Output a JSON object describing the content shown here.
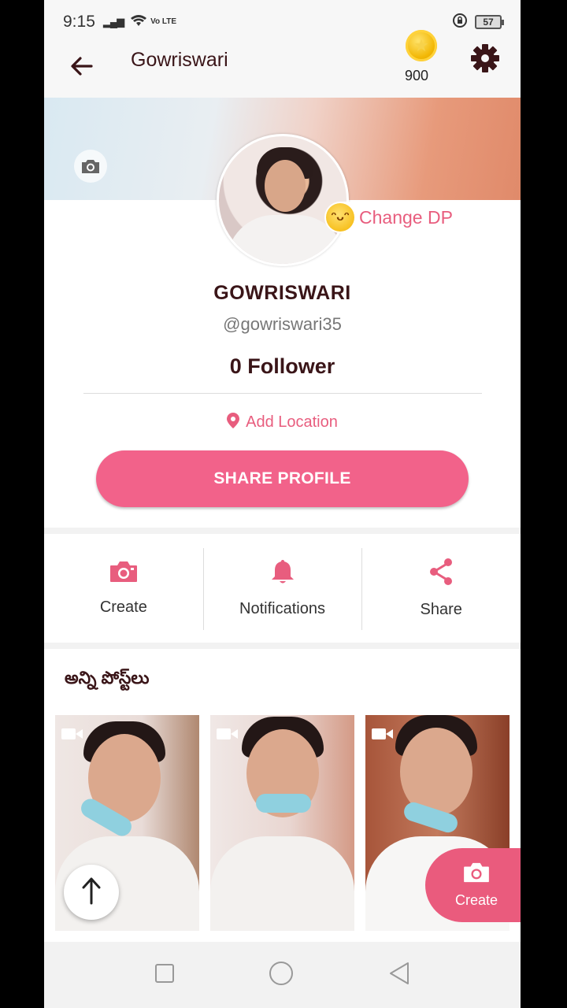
{
  "status_bar": {
    "time": "9:15",
    "network": "Vo LTE",
    "battery": "57"
  },
  "app_bar": {
    "title": "Gowriswari",
    "coin_count": "900",
    "icons": [
      "back-arrow-icon",
      "coin-icon",
      "gear-icon"
    ]
  },
  "profile": {
    "change_dp_label": "Change DP",
    "display_name": "GOWRISWARI",
    "handle": "@gowriswari35",
    "followers_label": "0 Follower",
    "location_label": "Add Location",
    "share_button_label": "SHARE PROFILE"
  },
  "actions": [
    {
      "label": "Create",
      "icon": "camera-icon"
    },
    {
      "label": "Notifications",
      "icon": "bell-icon"
    },
    {
      "label": "Share",
      "icon": "share-icon"
    }
  ],
  "posts": {
    "title": "అన్ని పోస్ట్‌లు",
    "items": [
      {
        "type": "video"
      },
      {
        "type": "video"
      },
      {
        "type": "video"
      }
    ]
  },
  "fab": {
    "create_label": "Create"
  },
  "colors": {
    "accent": "#f2628a",
    "title_text": "#3a1518",
    "link_pink": "#e85d7e"
  }
}
